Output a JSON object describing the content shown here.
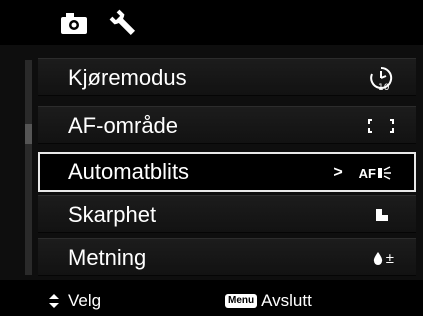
{
  "tabs": [
    {
      "icon": "camera-icon",
      "selected": true
    },
    {
      "icon": "wrench-icon",
      "selected": false
    }
  ],
  "menu": {
    "items": [
      {
        "label": "Kjøremodus",
        "value_icon": "self-timer-icon"
      },
      {
        "label": "AF-område",
        "value_icon": "af-area-brackets-icon"
      },
      {
        "label": "Automatblits",
        "value_icon": "af-assist-lamp-icon",
        "value_text": "AF"
      },
      {
        "label": "Skarphet",
        "value_icon": "sharpness-icon"
      },
      {
        "label": "Metning",
        "value_icon": "saturation-icon",
        "value_text": "±"
      }
    ],
    "selected_index": 2
  },
  "footer": {
    "select_label": "Velg",
    "menu_key": "Menu",
    "exit_label": "Avslutt"
  },
  "colors": {
    "background": "#000000",
    "row": "#1a1a1a",
    "selection_border": "#e8e8e8",
    "text": "#ffffff"
  }
}
